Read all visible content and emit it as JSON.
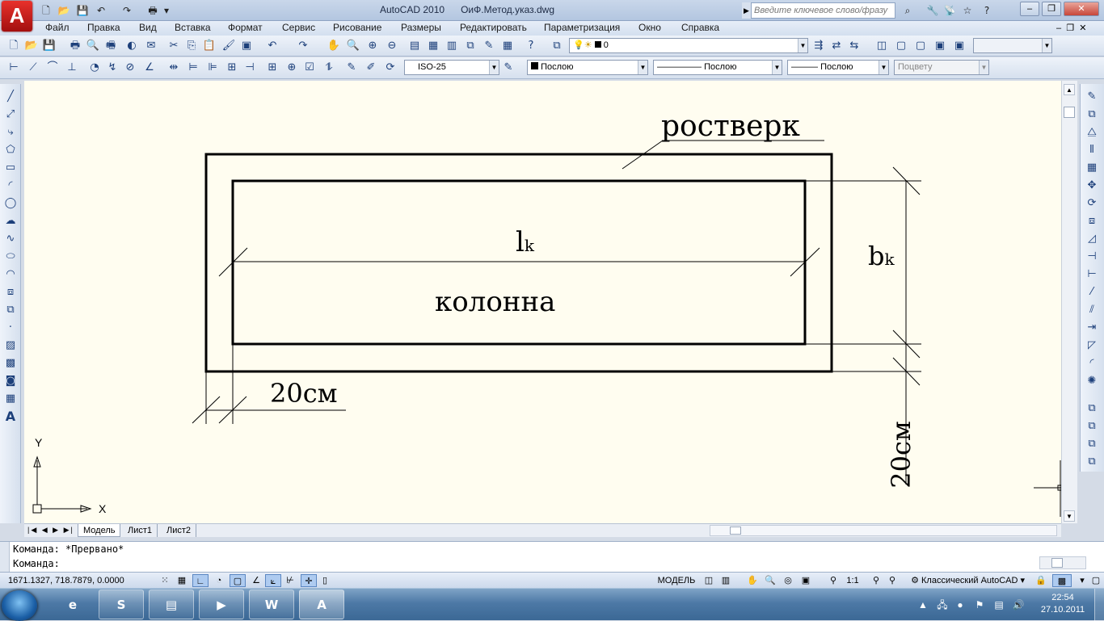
{
  "window": {
    "app_title": "AutoCAD 2010",
    "file_name": "ОиФ.Метод.указ.dwg",
    "search_placeholder": "Введите ключевое слово/фразу",
    "logo_letter": "A"
  },
  "menu": [
    "Файл",
    "Правка",
    "Вид",
    "Вставка",
    "Формат",
    "Сервис",
    "Рисование",
    "Размеры",
    "Редактировать",
    "Параметризация",
    "Окно",
    "Справка"
  ],
  "toolbar": {
    "layer_value": "0",
    "dimstyle_value": "ISO-25",
    "color_value": "Послою",
    "linetype_value": "Послою",
    "lineweight_value": "Послою",
    "plotstyle_value": "Поцвету"
  },
  "drawing": {
    "label_rostverk": "ростверк",
    "label_lk_main": "l",
    "label_lk_sub": "k",
    "label_bk_main": "b",
    "label_bk_sub": "k",
    "label_kolonna": "колонна",
    "label_20cm_horizontal": "20см",
    "label_20cm_vertical": "20см",
    "ucs_x": "X",
    "ucs_y": "Y"
  },
  "tabs": [
    "Модель",
    "Лист1",
    "Лист2"
  ],
  "command": {
    "line1": "Команда: *Прервано*",
    "line2": "Команда:"
  },
  "status": {
    "coordinates": "1671.1327, 718.7879, 0.0000",
    "space": "МОДЕЛЬ",
    "scale": "1:1",
    "workspace": "Классический AutoCAD"
  },
  "taskbar": {
    "time": "22:54",
    "date": "27.10.2011"
  }
}
